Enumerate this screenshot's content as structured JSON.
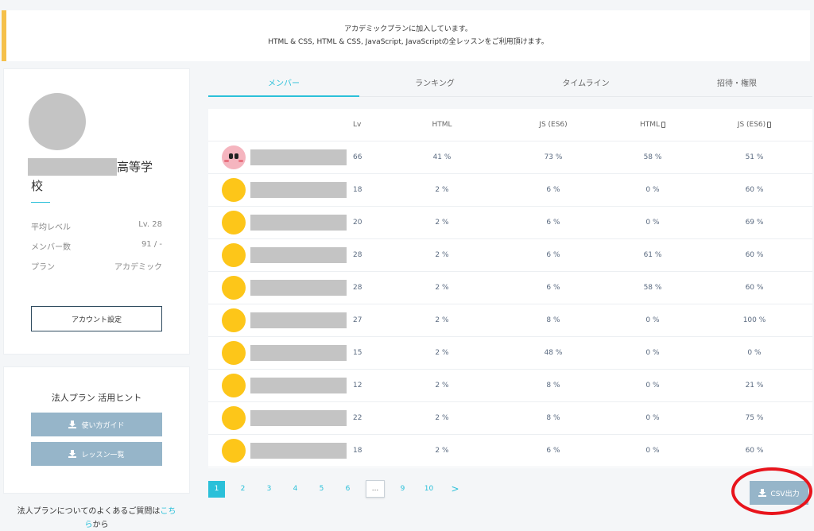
{
  "banner": {
    "line1": "アカデミックプランに加入しています。",
    "line2": "HTML & CSS, HTML & CSS, JavaScript, JavaScriptの全レッスンをご利用頂けます。"
  },
  "profile": {
    "school_suffix_a": "高等学",
    "school_suffix_b": "校",
    "stats": [
      {
        "label": "平均レベル",
        "value": "Lv. 28"
      },
      {
        "label": "メンバー数",
        "value": "91 / -"
      },
      {
        "label": "プラン",
        "value": "アカデミック"
      }
    ],
    "account_button": "アカウント設定"
  },
  "hints": {
    "title": "法人プラン 活用ヒント",
    "guide_button": "使い方ガイド",
    "lessons_button": "レッスン一覧"
  },
  "faq": {
    "text": "法人プランについてのよくあるご質問は",
    "link_a": "こち",
    "link_b": "ら",
    "suffix": "から"
  },
  "tabs": [
    {
      "label": "メンバー",
      "active": true
    },
    {
      "label": "ランキング",
      "active": false
    },
    {
      "label": "タイムライン",
      "active": false
    },
    {
      "label": "招待・権限",
      "active": false
    }
  ],
  "table": {
    "headers": {
      "lv": "Lv",
      "html": "HTML",
      "js": "JS (ES6)",
      "html_m": "HTML",
      "js_m": "JS (ES6)"
    },
    "rows": [
      {
        "lv": "66",
        "html": "41 %",
        "js": "73 %",
        "html_m": "58 %",
        "js_m": "51 %"
      },
      {
        "lv": "18",
        "html": "2 %",
        "js": "6 %",
        "html_m": "0 %",
        "js_m": "60 %"
      },
      {
        "lv": "20",
        "html": "2 %",
        "js": "6 %",
        "html_m": "0 %",
        "js_m": "69 %"
      },
      {
        "lv": "28",
        "html": "2 %",
        "js": "6 %",
        "html_m": "61 %",
        "js_m": "60 %"
      },
      {
        "lv": "28",
        "html": "2 %",
        "js": "6 %",
        "html_m": "58 %",
        "js_m": "60 %"
      },
      {
        "lv": "27",
        "html": "2 %",
        "js": "8 %",
        "html_m": "0 %",
        "js_m": "100 %"
      },
      {
        "lv": "15",
        "html": "2 %",
        "js": "48 %",
        "html_m": "0 %",
        "js_m": "0 %"
      },
      {
        "lv": "12",
        "html": "2 %",
        "js": "8 %",
        "html_m": "0 %",
        "js_m": "21 %"
      },
      {
        "lv": "22",
        "html": "2 %",
        "js": "8 %",
        "html_m": "0 %",
        "js_m": "75 %"
      },
      {
        "lv": "18",
        "html": "2 %",
        "js": "6 %",
        "html_m": "0 %",
        "js_m": "60 %"
      }
    ]
  },
  "pagination": {
    "pages": [
      "1",
      "2",
      "3",
      "4",
      "5",
      "6",
      "...",
      "9",
      "10",
      ">"
    ],
    "active": "1"
  },
  "csv_button": "CSV出力",
  "colors": {
    "accent": "#2bc0d9",
    "banner_border": "#f5c04a",
    "button_bg": "#96b5c9",
    "highlight_circle": "#e8141c",
    "avatar_yellow": "#fdc619"
  }
}
